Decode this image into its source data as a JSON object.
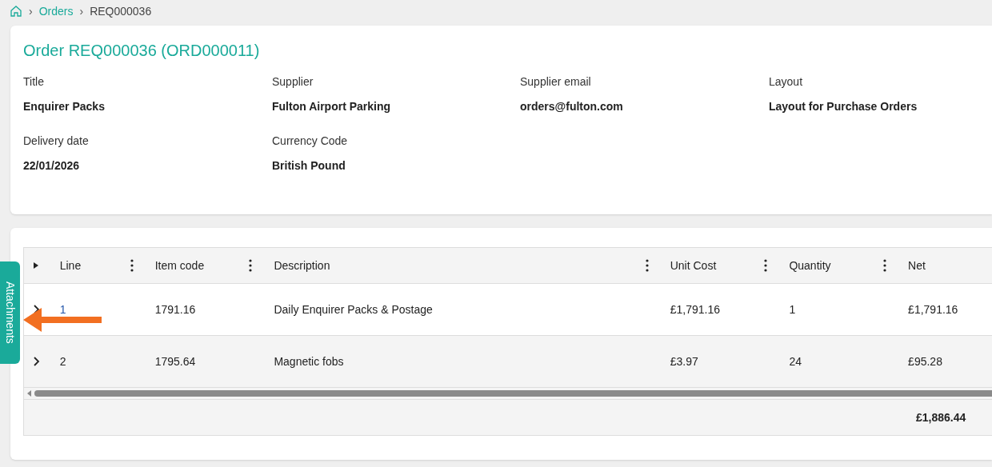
{
  "breadcrumb": {
    "items": [
      {
        "label": "Orders",
        "kind": "link"
      },
      {
        "label": "REQ000036",
        "kind": "current"
      }
    ],
    "separator": "›"
  },
  "order": {
    "title": "Order REQ000036 (ORD000011)",
    "fields": [
      {
        "label": "Title",
        "value": "Enquirer Packs"
      },
      {
        "label": "Supplier",
        "value": "Fulton Airport Parking"
      },
      {
        "label": "Supplier email",
        "value": "orders@fulton.com"
      },
      {
        "label": "Layout",
        "value": "Layout for Purchase Orders"
      },
      {
        "label": "Delivery date",
        "value": "22/01/2026"
      },
      {
        "label": "Currency Code",
        "value": "British Pound"
      }
    ]
  },
  "attachments_tab": {
    "label": "Attachments"
  },
  "table": {
    "columns": [
      "Line",
      "Item code",
      "Description",
      "Unit Cost",
      "Quantity",
      "Net"
    ],
    "rows": [
      {
        "cells": [
          "1",
          "1791.16",
          "Daily Enquirer Packs & Postage",
          "£1,791.16",
          "1",
          "£1,791.16"
        ],
        "expanded": false
      },
      {
        "cells": [
          "2",
          "1795.64",
          "Magnetic fobs",
          "£3.97",
          "24",
          "£95.28"
        ],
        "expanded": false
      }
    ],
    "total": "£1,886.44"
  }
}
